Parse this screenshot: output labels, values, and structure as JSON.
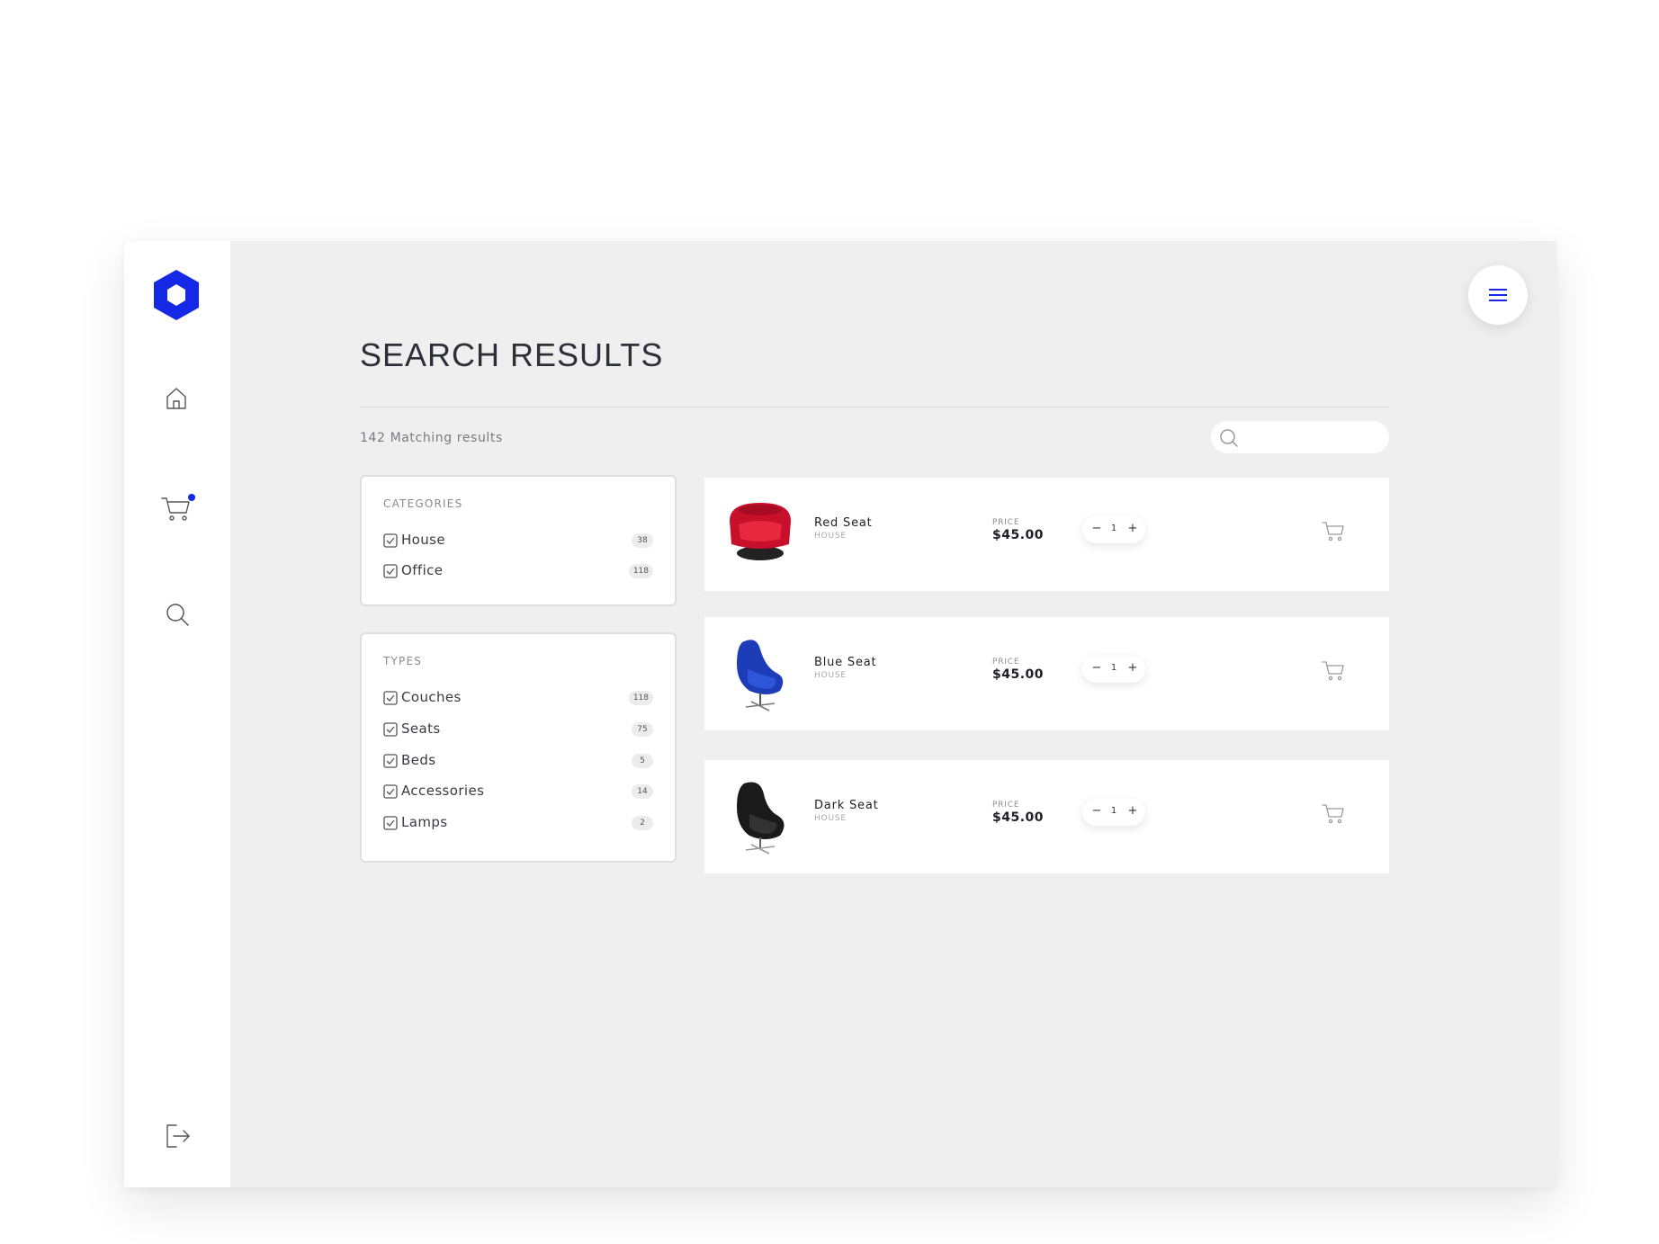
{
  "colors": {
    "accent": "#1428e6",
    "background": "#efefef",
    "card": "#ffffff"
  },
  "sidebar": {
    "logo": "hexagon-logo-icon",
    "items": [
      {
        "icon": "home-icon"
      },
      {
        "icon": "cart-icon",
        "badge": "notification-dot"
      },
      {
        "icon": "search-icon"
      }
    ],
    "footer_icon": "logout-icon"
  },
  "header": {
    "title": "SEARCH RESULTS",
    "menu_icon": "hamburger-menu-icon"
  },
  "results": {
    "count_text": "142 Matching results"
  },
  "search": {
    "value": "",
    "placeholder": ""
  },
  "filters": {
    "categories": {
      "heading": "CATEGORIES",
      "items": [
        {
          "label": "House",
          "count": "38",
          "checked": true
        },
        {
          "label": "Office",
          "count": "118",
          "checked": true
        }
      ]
    },
    "types": {
      "heading": "TYPES",
      "items": [
        {
          "label": "Couches",
          "count": "118",
          "checked": true
        },
        {
          "label": "Seats",
          "count": "75",
          "checked": true
        },
        {
          "label": "Beds",
          "count": "5",
          "checked": true
        },
        {
          "label": "Accessories",
          "count": "14",
          "checked": true
        },
        {
          "label": "Lamps",
          "count": "2",
          "checked": true
        }
      ]
    }
  },
  "products": [
    {
      "name": "Red Seat",
      "category": "HOUSE",
      "price_label": "PRICE",
      "price": "$45.00",
      "quantity": "1",
      "color": "#d81530"
    },
    {
      "name": "Blue Seat",
      "category": "HOUSE",
      "price_label": "PRICE",
      "price": "$45.00",
      "quantity": "1",
      "color": "#1f3fbf"
    },
    {
      "name": "Dark Seat",
      "category": "HOUSE",
      "price_label": "PRICE",
      "price": "$45.00",
      "quantity": "1",
      "color": "#1c1c1c"
    }
  ],
  "stepper": {
    "minus": "−",
    "plus": "+"
  }
}
